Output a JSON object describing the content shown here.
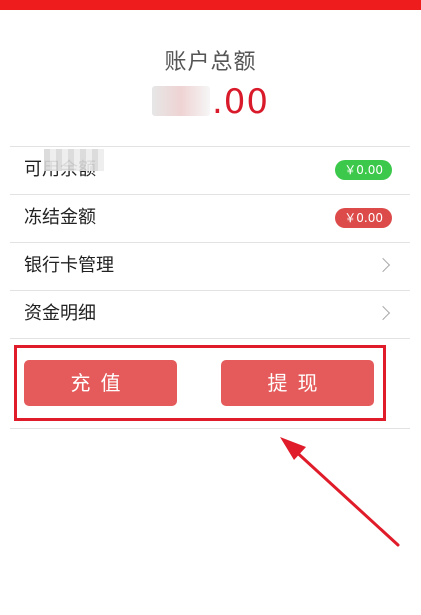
{
  "account": {
    "title": "账户总额",
    "amount_suffix": ".00"
  },
  "rows": {
    "available": {
      "label": "可用余额",
      "value": "￥0.00"
    },
    "frozen": {
      "label": "冻结金额",
      "value": "￥0.00"
    },
    "bank_card": {
      "label": "银行卡管理"
    },
    "fund_detail": {
      "label": "资金明细"
    }
  },
  "buttons": {
    "recharge": "充值",
    "withdraw": "提现"
  },
  "colors": {
    "top_bar": "#ee1c1c",
    "amount": "#d91a2a",
    "badge_green": "#3cc84b",
    "badge_red": "#dc4a4a",
    "button": "#e55a5a",
    "highlight": "#e01c2a"
  }
}
